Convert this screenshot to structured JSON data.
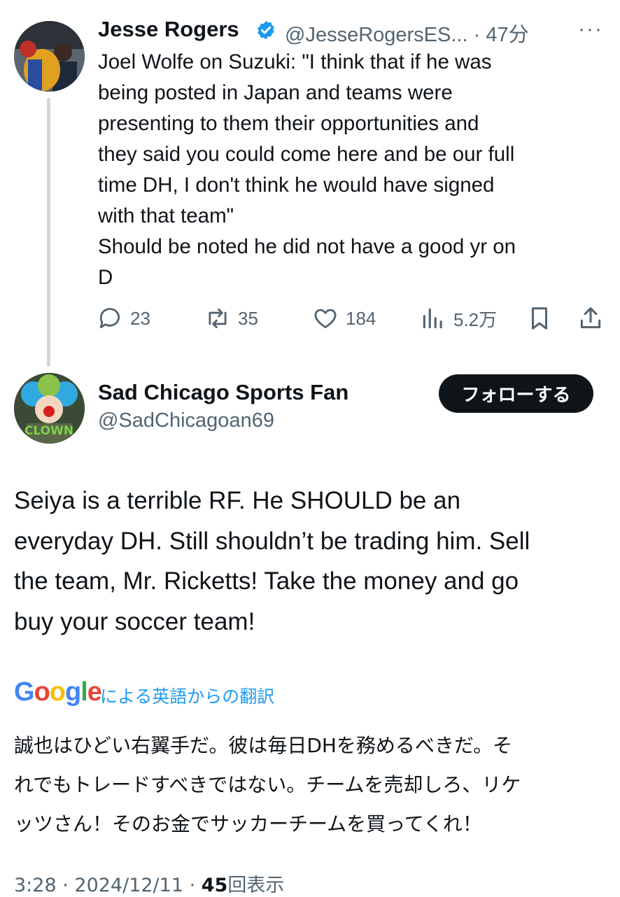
{
  "tweet1": {
    "display_name": "Jesse Rogers",
    "handle": "@JesseRogersES...",
    "separator": "·",
    "time": "47分",
    "text": "Joel Wolfe on Suzuki: \"I think that if he was\nbeing posted in Japan and teams were\npresenting to them their opportunities and\nthey said you could come here and be our full\ntime DH, I don't think he would have signed\nwith that team\"\nShould be noted he did not have a good yr on\nD",
    "replies": "23",
    "reposts": "35",
    "likes": "184",
    "views": "5.2万"
  },
  "tweet2": {
    "display_name": "Sad Chicago Sports Fan",
    "handle": "@SadChicagoan69",
    "follow_label": "フォローする",
    "avatar_caption": "CLOWN",
    "text": "Seiya is a terrible RF. He SHOULD be an\neveryday DH. Still shouldn’t be trading him. Sell\nthe team, Mr. Ricketts! Take the money and go\nbuy your soccer team!",
    "translation_brand": "Google",
    "translation_label": "による英語からの翻訳",
    "translated_text": "誠也はひどい右翼手だ。彼は毎日DHを務めるべきだ。そ\nれでもトレードすべきではない。チームを売却しろ、リケ\nッツさん！そのお金でサッカーチームを買ってくれ！",
    "time": "3:28",
    "date": "2024/12/11",
    "view_count": "45",
    "view_label": "回表示"
  },
  "colors": {
    "text": "#0f1419",
    "secondary": "#536471",
    "link": "#1d9bf0",
    "verified": "#1d9bf0",
    "follow_button_bg": "#0f1419"
  },
  "icons": [
    "verified-badge-icon",
    "more-icon",
    "reply-icon",
    "repost-icon",
    "like-icon",
    "views-icon",
    "bookmark-icon",
    "share-icon"
  ]
}
